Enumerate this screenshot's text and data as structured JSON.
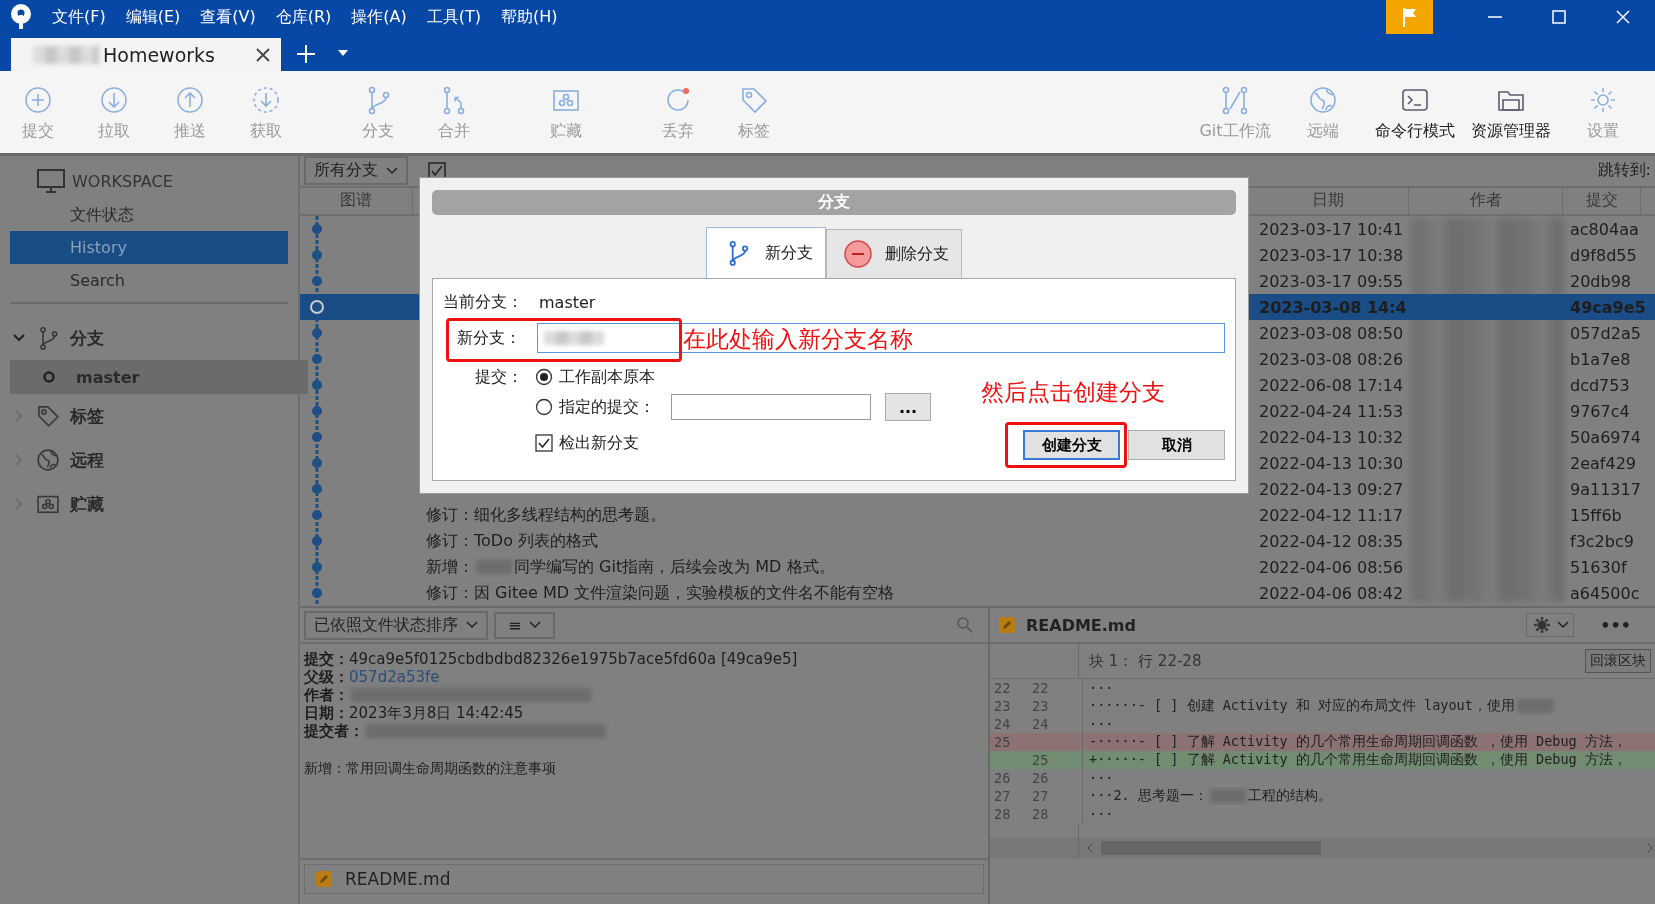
{
  "menu": [
    "文件(F)",
    "编辑(E)",
    "查看(V)",
    "仓库(R)",
    "操作(A)",
    "工具(T)",
    "帮助(H)"
  ],
  "repo_tab": {
    "title": "Homeworks",
    "redacted_prefix": true
  },
  "toolbar": {
    "left_groups": [
      [
        {
          "label": "提交",
          "disabled": true
        },
        {
          "label": "拉取",
          "disabled": true
        },
        {
          "label": "推送",
          "disabled": true
        },
        {
          "label": "获取",
          "disabled": true
        }
      ],
      [
        {
          "label": "分支",
          "disabled": true
        },
        {
          "label": "合并",
          "disabled": true
        }
      ],
      [
        {
          "label": "贮藏",
          "disabled": true
        }
      ],
      [
        {
          "label": "丢弃",
          "disabled": true
        },
        {
          "label": "标签",
          "disabled": true
        }
      ]
    ],
    "right": [
      {
        "label": "Git工作流",
        "disabled": true
      },
      {
        "label": "远端",
        "disabled": true
      },
      {
        "label": "命令行模式",
        "disabled": false
      },
      {
        "label": "资源管理器",
        "disabled": false
      },
      {
        "label": "设置",
        "disabled": true
      }
    ]
  },
  "sidebar": {
    "workspace": {
      "title": "WORKSPACE",
      "items": [
        {
          "label": "文件状态",
          "selected": false
        },
        {
          "label": "History",
          "selected": true
        },
        {
          "label": "Search",
          "selected": false
        }
      ]
    },
    "sections": [
      {
        "label": "分支",
        "expanded": true,
        "children": [
          {
            "label": "master",
            "selected": true
          }
        ]
      },
      {
        "label": "标签",
        "expanded": false
      },
      {
        "label": "远程",
        "expanded": false
      },
      {
        "label": "贮藏",
        "expanded": false
      }
    ]
  },
  "history": {
    "branch_filter": "所有分支",
    "show_remote_checked": true,
    "jump_label": "跳转到:",
    "columns": {
      "graph": "图谱",
      "date": "日期",
      "author": "作者",
      "commit": "提交"
    },
    "rows": [
      {
        "date": "2023-03-17 10:41",
        "hash": "ac804aa",
        "selected": false
      },
      {
        "date": "2023-03-17 10:38",
        "hash": "d9f8d55",
        "selected": false
      },
      {
        "date": "2023-03-17 09:55",
        "hash": "20db98",
        "selected": false
      },
      {
        "date": "2023-03-08 14:4",
        "hash": "49ca9e5",
        "selected": true
      },
      {
        "date": "2023-03-08 08:50",
        "hash": "057d2a5",
        "selected": false
      },
      {
        "date": "2023-03-08 08:26",
        "hash": "b1a7e8",
        "selected": false
      },
      {
        "date": "2022-06-08 17:14",
        "hash": "dcd753",
        "selected": false
      },
      {
        "date": "2022-04-24 11:53",
        "hash": "9767c4",
        "selected": false
      },
      {
        "date": "2022-04-13 10:32",
        "hash": "50a6974",
        "selected": false
      },
      {
        "date": "2022-04-13 10:30",
        "hash": "2eaf429",
        "selected": false
      },
      {
        "date": "2022-04-13 09:27",
        "hash": "9a11317",
        "selected": false
      },
      {
        "message": "修订：细化多线程结构的思考题。",
        "date": "2022-04-12 11:17",
        "hash": "15ff6b",
        "selected": false
      },
      {
        "message": "修订：ToDo 列表的格式",
        "date": "2022-04-12 08:35",
        "hash": "f3c2bc9",
        "selected": false
      },
      {
        "message": "新增：",
        "message_redacted": true,
        "message_tail": "同学编写的 Git指南，后续会改为 MD 格式。",
        "date": "2022-04-06 08:56",
        "hash": "51630f",
        "selected": false
      },
      {
        "message": "修订：因 Gitee MD 文件渲染问题，实验模板的文件名不能有空格",
        "date": "2022-04-06 08:42",
        "hash": "a64500c",
        "selected": false
      }
    ]
  },
  "details": {
    "sort_label": "已依照文件状态排序",
    "view_icon": "≡",
    "fields": [
      {
        "label": "提交：",
        "kind": "text",
        "value": "49ca9e5f0125cbdbdbd82326e1975b7ace5fd60a [49ca9e5]"
      },
      {
        "label": "父级：",
        "kind": "link",
        "value": "057d2a53fe"
      },
      {
        "label": "作者：",
        "kind": "redacted"
      },
      {
        "label": "日期：",
        "kind": "text",
        "value": "2023年3月8日 14:42:45"
      },
      {
        "label": "提交者：",
        "kind": "redacted"
      }
    ],
    "message": "新增：常用回调生命周期函数的注意事项",
    "files": [
      "README.md"
    ]
  },
  "diff": {
    "file": "README.md",
    "hunk": "块 1： 行 22-28",
    "revert_button": "回滚区块",
    "more": "•••",
    "lines": [
      {
        "old": "22",
        "new": "22",
        "kind": "context",
        "text": "···"
      },
      {
        "old": "23",
        "new": "23",
        "kind": "context",
        "text": "······- [ ] 创建 Activity 和 对应的布局文件 layout，使用 ",
        "redacted": true
      },
      {
        "old": "24",
        "new": "24",
        "kind": "context",
        "text": "···"
      },
      {
        "old": "25",
        "kind": "removed",
        "text": "-·····- [ ] 了解 Activity 的几个常用生命周期回调函数 ，使用 Debug 方法，"
      },
      {
        "new": "25",
        "kind": "added",
        "text": "+·····- [ ] 了解 Activity 的几个常用生命周期回调函数 ，使用 Debug 方法，"
      },
      {
        "old": "26",
        "new": "26",
        "kind": "context",
        "text": "···"
      },
      {
        "old": "27",
        "new": "27",
        "kind": "context",
        "text": "···2. 思考题一：",
        "redacted": true,
        "tail": "工程的结构。"
      },
      {
        "old": "28",
        "new": "28",
        "kind": "context",
        "text": "···"
      }
    ]
  },
  "dialog": {
    "title": "分支",
    "tabs": [
      {
        "label": "新分支",
        "selected": true
      },
      {
        "label": "删除分支",
        "selected": false
      }
    ],
    "current_label": "当前分支：",
    "current_value": "master",
    "new_label": "新分支：",
    "new_value_redacted": true,
    "commit_label": "提交：",
    "options": [
      {
        "label": "工作副本原本",
        "selected": true
      },
      {
        "label": "指定的提交：",
        "selected": false
      }
    ],
    "browse_button": "...",
    "checkout": {
      "label": "检出新分支",
      "checked": true
    },
    "create_button": "创建分支",
    "cancel_button": "取消",
    "annotations": [
      {
        "text": "在此处输入新分支名称"
      },
      {
        "text": "然后点击创建分支"
      }
    ]
  }
}
